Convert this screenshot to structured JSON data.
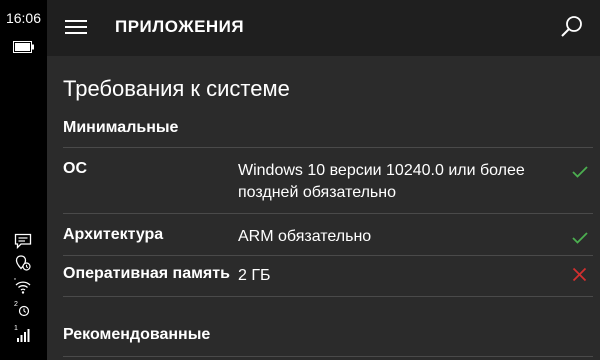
{
  "status_bar": {
    "time": "16:06",
    "icons": [
      "battery-icon",
      "message-icon",
      "location-icon",
      "wifi-icon",
      "sim2-signal-icon",
      "sim1-signal-icon"
    ],
    "sim2_label": "2",
    "sim1_label": "1"
  },
  "header": {
    "menu_icon": "hamburger-menu-icon",
    "title": "ПРИЛОЖЕНИЯ",
    "search_icon": "search-icon"
  },
  "page": {
    "section_title": "Требования к системе",
    "minimal": {
      "heading": "Минимальные",
      "rows": [
        {
          "label": "ОС",
          "value": "Windows 10 версии 10240.0 или более поздней обязательно",
          "status": "met",
          "status_icon": "check-icon"
        },
        {
          "label": "Архитектура",
          "value": "ARM обязательно",
          "status": "met",
          "status_icon": "check-icon"
        },
        {
          "label": "Оперативная память",
          "value": "2 ГБ",
          "status": "not-met",
          "status_icon": "cross-icon"
        }
      ]
    },
    "recommended": {
      "heading": "Рекомендованные"
    }
  },
  "colors": {
    "background": "#2b2b2b",
    "header_background": "#1f1f1f",
    "status_bar_background": "#000000",
    "text": "#ffffff",
    "divider": "#4a4a4a",
    "check": "#4caf50",
    "cross": "#d32f2f"
  }
}
